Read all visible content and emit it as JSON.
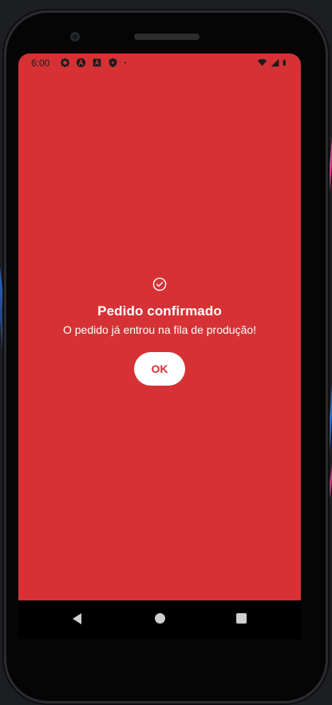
{
  "status_bar": {
    "time": "6:00",
    "left_icons": [
      "gear-icon",
      "a-circle-icon",
      "a-box-icon",
      "play-shield-icon",
      "dot-icon"
    ],
    "right_icons": [
      "wifi-icon",
      "signal-icon",
      "battery-icon"
    ]
  },
  "dialog": {
    "icon": "check-circle-icon",
    "title": "Pedido confirmado",
    "message": "O pedido já entrou na fila de produção!",
    "ok_label": "OK"
  },
  "nav_bar": {
    "buttons": [
      "back",
      "home",
      "recents"
    ]
  },
  "colors": {
    "screen_background": "#d63235",
    "button_background": "#ffffff",
    "button_text": "#d63235",
    "text": "#ffffff"
  }
}
